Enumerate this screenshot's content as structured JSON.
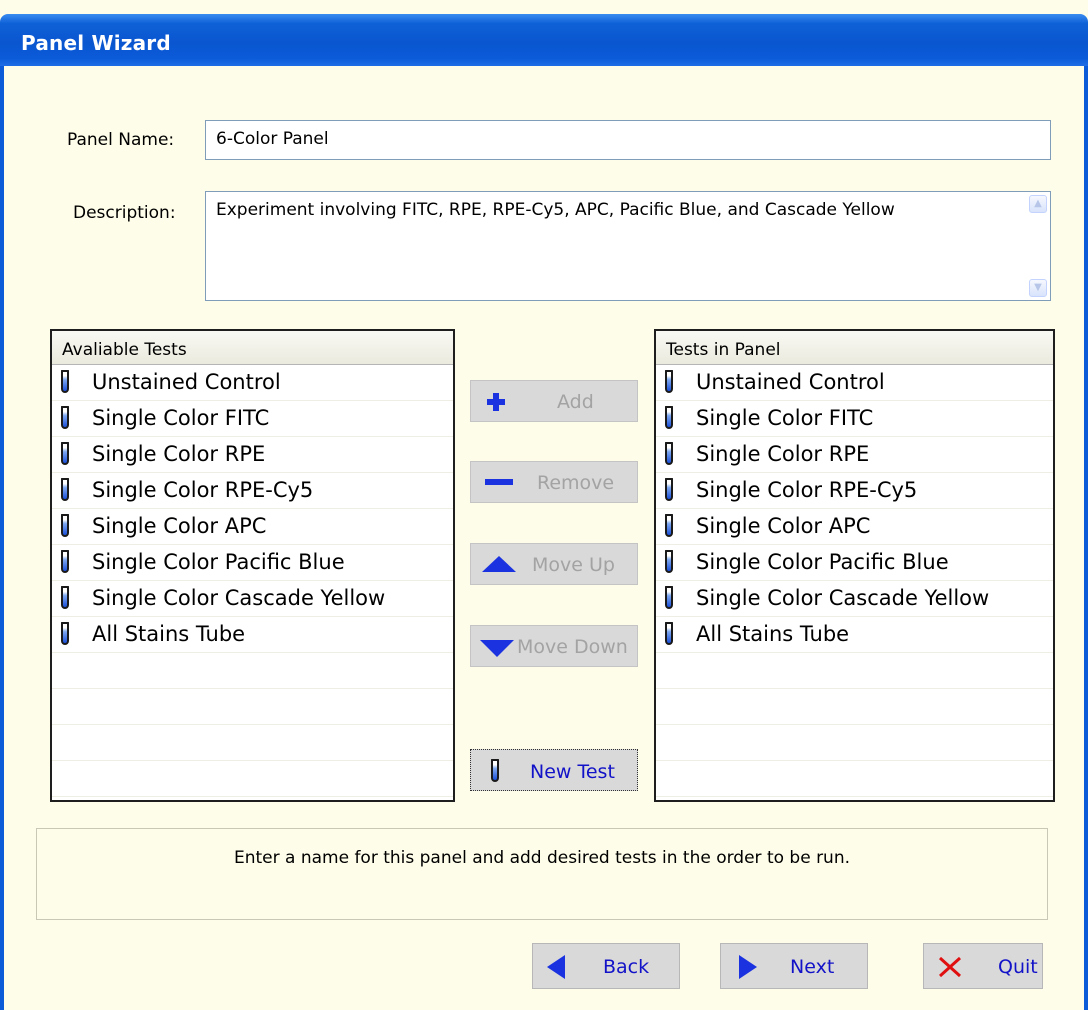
{
  "window": {
    "title": "Panel Wizard"
  },
  "form": {
    "panel_name_label": "Panel Name:",
    "panel_name_value": "6-Color Panel",
    "description_label": "Description:",
    "description_value": "Experiment involving FITC, RPE, RPE-Cy5, APC, Pacific Blue, and Cascade Yellow"
  },
  "available": {
    "header": "Avaliable Tests",
    "items": [
      "Unstained Control",
      "Single Color FITC",
      "Single Color RPE",
      "Single Color RPE-Cy5",
      "Single Color APC",
      "Single Color Pacific Blue",
      "Single Color Cascade Yellow",
      "All Stains Tube"
    ]
  },
  "panel": {
    "header": "Tests in Panel",
    "items": [
      "Unstained Control",
      "Single Color FITC",
      "Single Color RPE",
      "Single Color RPE-Cy5",
      "Single Color APC",
      "Single Color Pacific Blue",
      "Single Color Cascade Yellow",
      "All Stains Tube"
    ]
  },
  "actions": {
    "add": "Add",
    "remove": "Remove",
    "move_up": "Move Up",
    "move_down": "Move Down",
    "new_test": "New Test"
  },
  "hint": "Enter a name for this panel and add desired tests in the order to be run.",
  "nav": {
    "back": "Back",
    "next": "Next",
    "quit": "Quit"
  },
  "icons": {
    "test": "test-tube-icon",
    "add": "plus-icon",
    "remove": "minus-icon",
    "up": "arrow-up-icon",
    "down": "arrow-down-icon",
    "back": "arrow-left-icon",
    "next": "arrow-right-icon",
    "quit": "close-icon"
  },
  "colors": {
    "titlebar": "#0a56d0",
    "background": "#fefde9",
    "icon_blue": "#1a32e0",
    "quit_red": "#e01010",
    "nav_text": "#1212c8"
  }
}
